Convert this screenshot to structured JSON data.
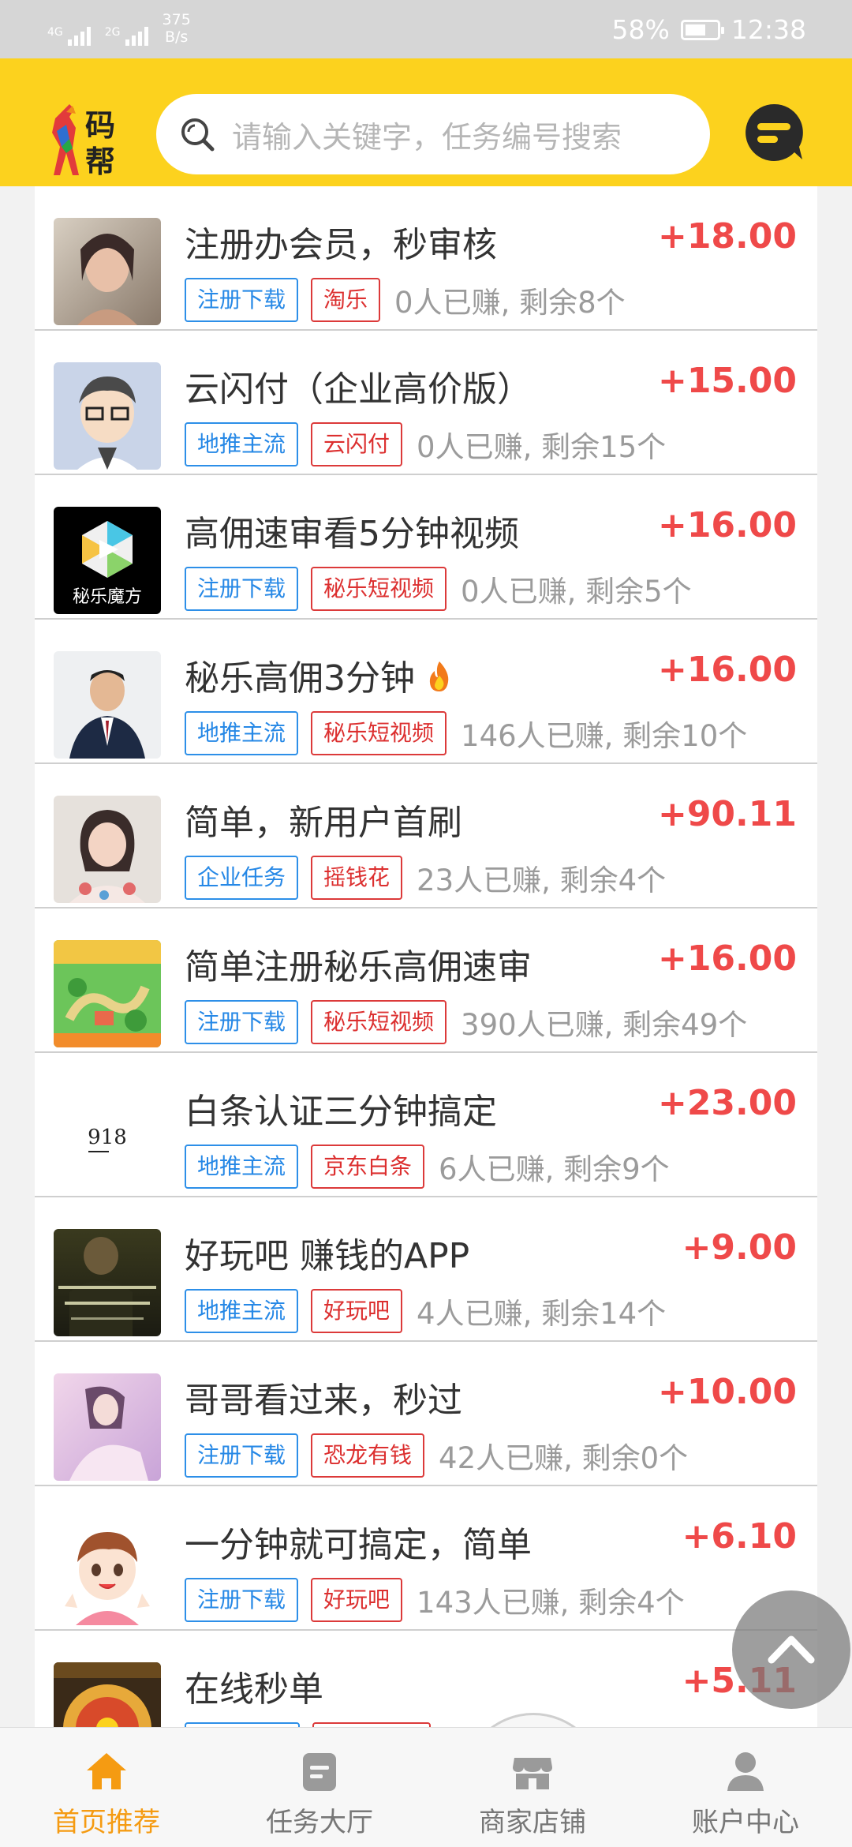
{
  "status_bar": {
    "network_1": "4G",
    "network_2": "2G",
    "speed_value": "375",
    "speed_unit": "B/s",
    "battery": "58%",
    "time": "12:38"
  },
  "header": {
    "logo_text_1": "码",
    "logo_text_2": "帮",
    "search_placeholder": "请输入关键字，任务编号搜索"
  },
  "tasks": [
    {
      "title": "注册办会员，秒审核",
      "reward": "+18.00",
      "type_tag": "注册下载",
      "app_tag": "淘乐",
      "count": "0人已赚, 剩余8个",
      "thumb": "woman-portrait"
    },
    {
      "title": "云闪付（企业高价版）",
      "reward": "+15.00",
      "type_tag": "地推主流",
      "app_tag": "云闪付",
      "count": "0人已赚, 剩余15个",
      "thumb": "cartoon-man"
    },
    {
      "title": "高佣速审看5分钟视频",
      "reward": "+16.00",
      "type_tag": "注册下载",
      "app_tag": "秘乐短视频",
      "count": "0人已赚, 剩余5个",
      "thumb": "mile-logo",
      "thumb_text": "秘乐魔方"
    },
    {
      "title": "秘乐高佣3分钟",
      "reward": "+16.00",
      "type_tag": "地推主流",
      "app_tag": "秘乐短视频",
      "count": "146人已赚, 剩余10个",
      "thumb": "man-suit",
      "hot": true
    },
    {
      "title": "简单，新用户首刷",
      "reward": "+90.11",
      "type_tag": "企业任务",
      "app_tag": "摇钱花",
      "count": "23人已赚, 剩余4个",
      "thumb": "girl-portrait"
    },
    {
      "title": "简单注册秘乐高佣速审",
      "reward": "+16.00",
      "type_tag": "注册下载",
      "app_tag": "秘乐短视频",
      "count": "390人已赚, 剩余49个",
      "thumb": "game-map"
    },
    {
      "title": "白条认证三分钟搞定",
      "reward": "+23.00",
      "type_tag": "地推主流",
      "app_tag": "京东白条",
      "count": "6人已赚, 剩余9个",
      "thumb": "text-918",
      "thumb_text": "918"
    },
    {
      "title": "好玩吧 赚钱的APP",
      "reward": "+9.00",
      "type_tag": "地推主流",
      "app_tag": "好玩吧",
      "count": "4人已赚, 剩余14个",
      "thumb": "dark-photo"
    },
    {
      "title": "哥哥看过来，秒过",
      "reward": "+10.00",
      "type_tag": "注册下载",
      "app_tag": "恐龙有钱",
      "count": "42人已赚, 剩余0个",
      "thumb": "pink-photo"
    },
    {
      "title": "一分钟就可搞定，简单",
      "reward": "+6.10",
      "type_tag": "注册下载",
      "app_tag": "好玩吧",
      "count": "143人已赚, 剩余4个",
      "thumb": "cartoon-boy"
    },
    {
      "title": "在线秒单",
      "reward": "+5.11",
      "type_tag": "",
      "app_tag": "",
      "count": "",
      "thumb": "wheel"
    }
  ],
  "nav": [
    {
      "label": "首页推荐",
      "icon": "home-icon",
      "active": true
    },
    {
      "label": "任务大厅",
      "icon": "task-icon",
      "active": false
    },
    {
      "label": "商家店铺",
      "icon": "shop-icon",
      "active": false
    },
    {
      "label": "账户中心",
      "icon": "user-icon",
      "active": false
    }
  ],
  "colors": {
    "brand_yellow": "#fcd21e",
    "reward_red": "#ef4949",
    "nav_active": "#f59b12",
    "tag_blue": "#2688e6",
    "tag_red": "#dc2f2f"
  }
}
